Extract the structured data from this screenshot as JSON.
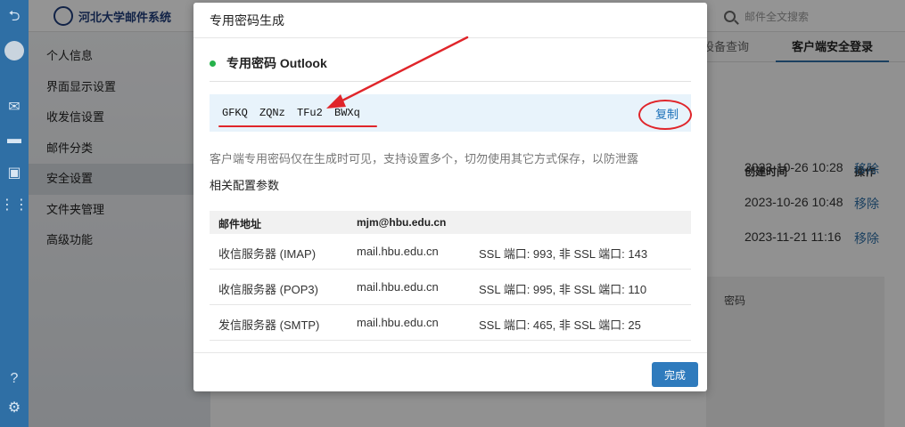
{
  "app": {
    "logo_text": "河北大学邮件系统"
  },
  "search": {
    "placeholder": "邮件全文搜索"
  },
  "sidebar": {
    "items": [
      {
        "label": "个人信息"
      },
      {
        "label": "界面显示设置"
      },
      {
        "label": "收发信设置"
      },
      {
        "label": "邮件分类"
      },
      {
        "label": "安全设置"
      },
      {
        "label": "文件夹管理"
      },
      {
        "label": "高级功能"
      }
    ],
    "active_index": 4
  },
  "main": {
    "tabs": [
      {
        "label": "设备查询"
      },
      {
        "label": "客户端安全登录"
      }
    ],
    "table_headers": {
      "created": "创建时间",
      "action": "操作"
    },
    "rows": [
      {
        "created": "2023-10-26 10:28",
        "action": "移除"
      },
      {
        "created": "2023-10-26 10:48",
        "action": "移除"
      },
      {
        "created": "2023-11-21 11:16",
        "action": "移除"
      }
    ],
    "panel_text": "密码"
  },
  "modal": {
    "title": "专用密码生成",
    "subtitle": "专用密码 Outlook",
    "password": "GFKQ ZQNz TFu2 BWXq",
    "copy_label": "复制",
    "notice": "客户端专用密码仅在生成时可见，支持设置多个，切勿使用其它方式保存，以防泄露",
    "config_title": "相关配置参数",
    "config_header": {
      "label": "邮件地址",
      "value": "mjm@hbu.edu.cn"
    },
    "config_rows": [
      {
        "name": "收信服务器 (IMAP)",
        "host": "mail.hbu.edu.cn",
        "ports": "SSL 端口: 993, 非 SSL 端口: 143"
      },
      {
        "name": "收信服务器 (POP3)",
        "host": "mail.hbu.edu.cn",
        "ports": "SSL 端口: 995, 非 SSL 端口: 110"
      },
      {
        "name": "发信服务器 (SMTP)",
        "host": "mail.hbu.edu.cn",
        "ports": "SSL 端口: 465, 非 SSL 端口: 25"
      }
    ],
    "done_label": "完成"
  },
  "colors": {
    "accent": "#2f6fa5",
    "annotation_red": "#e0252a",
    "success_dot": "#26b24b",
    "link_blue": "#1a6fb8"
  }
}
